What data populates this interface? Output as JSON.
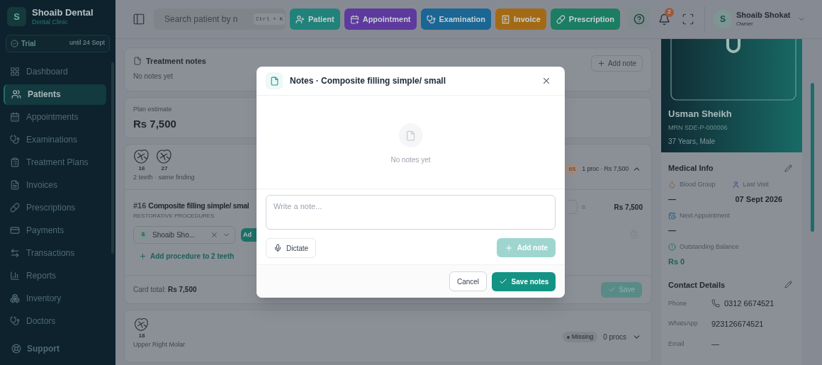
{
  "brand": {
    "initial": "S",
    "name": "Shoaib Dental",
    "subtitle": "Dental Clinic"
  },
  "trial": {
    "label": "Trial",
    "until": "until 24 Sept"
  },
  "sidebar": {
    "items": [
      {
        "label": "Dashboard",
        "selected": false
      },
      {
        "label": "Patients",
        "selected": true
      },
      {
        "label": "Appointments",
        "selected": false
      },
      {
        "label": "Examinations",
        "selected": false
      },
      {
        "label": "Treatment Plans",
        "selected": false
      },
      {
        "label": "Invoices",
        "selected": false
      },
      {
        "label": "Prescriptions",
        "selected": false
      },
      {
        "label": "Payments",
        "selected": false
      },
      {
        "label": "Transactions",
        "selected": false
      },
      {
        "label": "Reports",
        "selected": false
      },
      {
        "label": "Inventory",
        "selected": false
      },
      {
        "label": "Doctors",
        "selected": false
      }
    ],
    "footer": "Support"
  },
  "topbar": {
    "search": {
      "placeholder": "Search patient by n",
      "shortcut": "Ctrl + K"
    },
    "actions": [
      {
        "label": "Patient",
        "color": "#21827a"
      },
      {
        "label": "Appointment",
        "color": "#5e3a9e"
      },
      {
        "label": "Examination",
        "color": "#1b6694"
      },
      {
        "label": "Invoice",
        "color": "#a36a16"
      },
      {
        "label": "Prescription",
        "color": "#1b7d62"
      }
    ],
    "notifications": "2",
    "user": {
      "initial": "S",
      "name": "Shoaib Shokat",
      "role": "Owner"
    }
  },
  "treatment_notes": {
    "title": "Treatment notes",
    "empty": "No notes yet",
    "add": "Add note"
  },
  "plan_estimate": {
    "label": "Plan estimate",
    "amount": "Rs 7,500"
  },
  "finding_card": {
    "teeth": [
      "16",
      "27"
    ],
    "caption": "2 teeth · same finding",
    "badge": "es",
    "summary": "1 proc · Rs 7,500",
    "expanded": true,
    "procedure": {
      "code": "#16",
      "name": "Composite filling simple/ smal",
      "category": "RESTORATIVE PROCEDURES",
      "equals": "=",
      "price": "Rs 7,500"
    },
    "doctor": {
      "initial": "S",
      "name": "Shoaib Sho..."
    },
    "add_button": "Ad",
    "add_procedure": "Add procedure to 2 teeth",
    "total_label": "Card total:",
    "total": "Rs 7,500",
    "save": "Save"
  },
  "missing_card": {
    "teeth": [
      "18"
    ],
    "caption": "Upper Right Molar",
    "status": "Missing",
    "summary": "0 procs",
    "expanded": false
  },
  "patient": {
    "name": "Usman Sheikh",
    "mrn": "MRN SDE-P-000006",
    "details": "37 Years, Male"
  },
  "medical_info": {
    "title": "Medical Info",
    "fields": [
      {
        "label": "Blood Group",
        "value": "—"
      },
      {
        "label": "Last Visit",
        "value": "07 Sept 2026"
      },
      {
        "label": "Next Appointment",
        "value": "—"
      },
      {
        "label": "Outstanding Balance",
        "value": "Rs 0"
      }
    ]
  },
  "contact": {
    "title": "Contact Details",
    "rows": [
      {
        "label": "Phone",
        "value": "0312 6674521"
      },
      {
        "label": "WhatsApp",
        "value": "923126674521"
      },
      {
        "label": "Email",
        "value": "—"
      }
    ]
  },
  "modal": {
    "title": "Notes · Composite filling simple/ small",
    "empty": "No notes yet",
    "input": {
      "placeholder": "Write a note..."
    },
    "dictate": "Dictate",
    "add_note": {
      "label": "Add note",
      "disabled": true
    },
    "cancel": "Cancel",
    "save": "Save notes"
  }
}
